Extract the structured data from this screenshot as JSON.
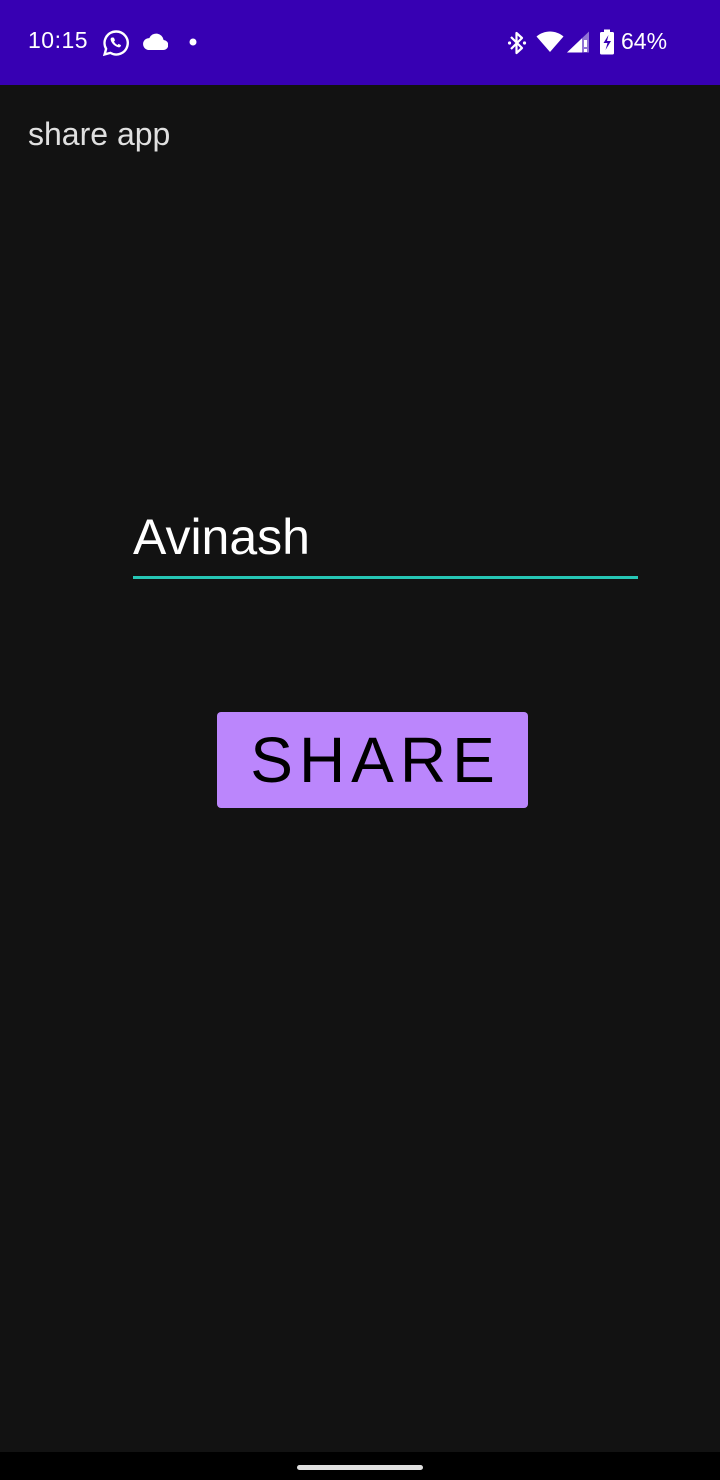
{
  "status_bar": {
    "time": "10:15",
    "battery_percent": "64%",
    "icons": [
      "whatsapp-icon",
      "cloud-icon",
      "dot-icon",
      "bluetooth-icon",
      "wifi-icon",
      "signal-icon",
      "battery-icon"
    ],
    "background_color": "#3700b3"
  },
  "app_bar": {
    "title": "share app"
  },
  "form": {
    "name_value": "Avinash",
    "underline_color": "#26c6b5"
  },
  "share_button": {
    "label": "SHARE",
    "color": "#bb86fc"
  },
  "nav_bar": {
    "icons": [
      "home-handle"
    ]
  }
}
